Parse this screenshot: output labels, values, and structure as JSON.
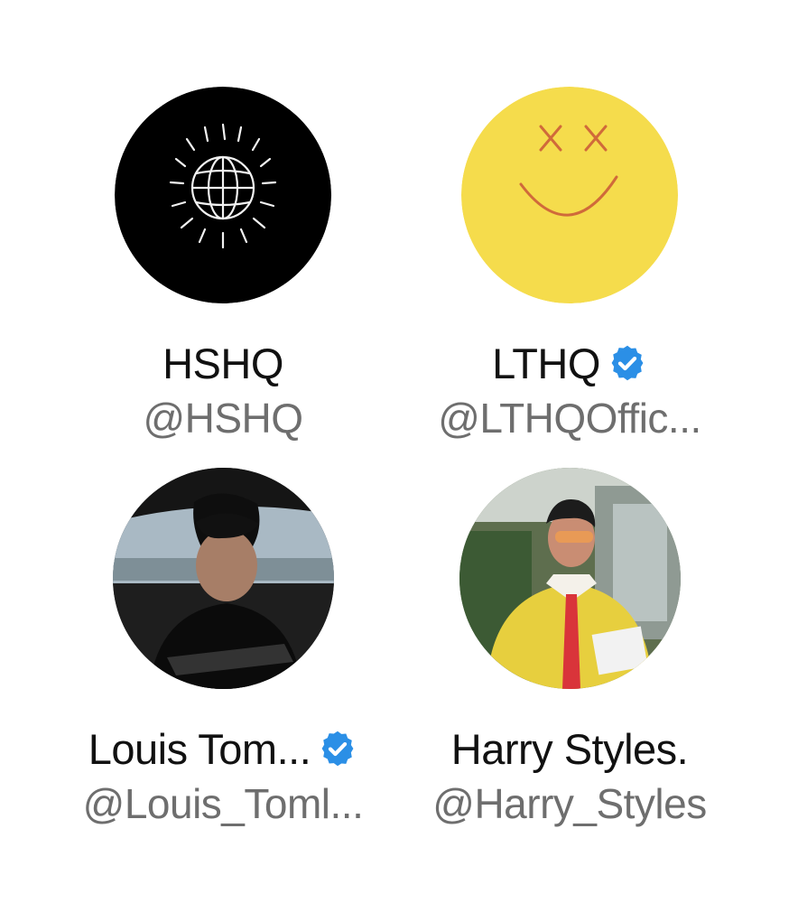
{
  "accounts": [
    {
      "name": "HSHQ",
      "handle": "@HSHQ",
      "verified": false,
      "avatar_icon": "globe-sun-logo-icon"
    },
    {
      "name": "LTHQ",
      "handle": "@LTHQOffic...",
      "verified": true,
      "avatar_icon": "smiley-face-logo-icon"
    },
    {
      "name": "Louis Tom...",
      "handle": "@Louis_Toml...",
      "verified": true,
      "avatar_icon": "profile-photo-man-in-car"
    },
    {
      "name": "Harry Styles.",
      "handle": "@Harry_Styles",
      "verified": false,
      "avatar_icon": "profile-photo-man-yellow-sweater"
    }
  ],
  "colors": {
    "verified_badge": "#2b8fe6",
    "name_text": "#111111",
    "handle_text": "#6e6e6e",
    "lthq_avatar": "#f5dc4c",
    "hshq_avatar": "#000000"
  }
}
